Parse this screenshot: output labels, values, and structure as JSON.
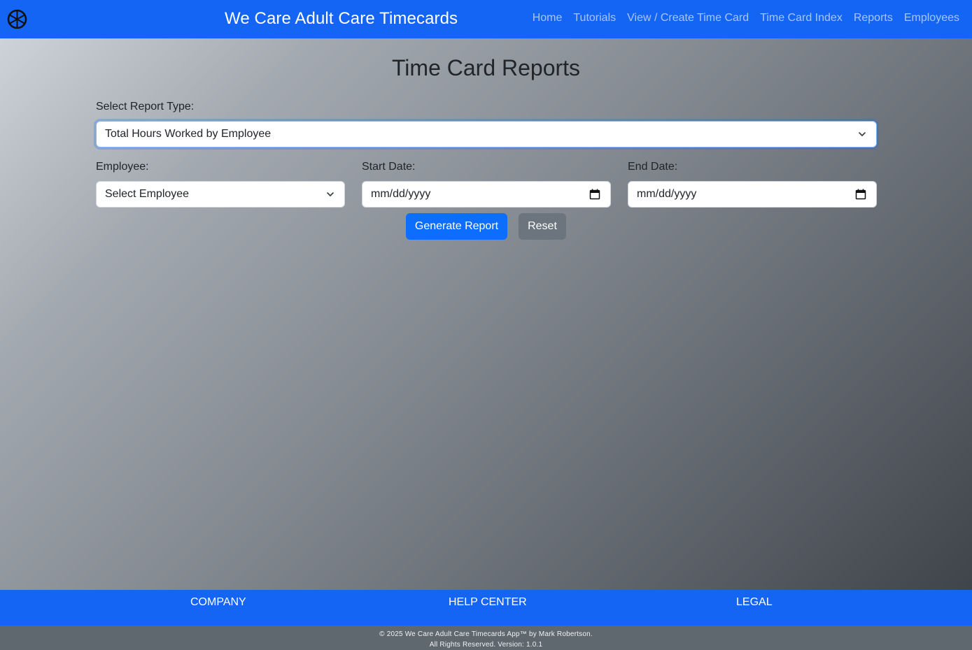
{
  "header": {
    "brand": "We Care Adult Care Timecards",
    "logo_icon": "wheel-icon",
    "nav": [
      "Home",
      "Tutorials",
      "View / Create Time Card",
      "Time Card Index",
      "Reports",
      "Employees"
    ]
  },
  "main": {
    "title": "Time Card Reports",
    "report_type": {
      "label": "Select Report Type:",
      "value": "Total Hours Worked by Employee"
    },
    "employee": {
      "label": "Employee:",
      "value": "Select Employee"
    },
    "start_date": {
      "label": "Start Date:",
      "placeholder": "mm/dd/yyyy"
    },
    "end_date": {
      "label": "End Date:",
      "placeholder": "mm/dd/yyyy"
    },
    "buttons": {
      "generate": "Generate Report",
      "reset": "Reset"
    }
  },
  "footer": {
    "columns": [
      "COMPANY",
      "HELP CENTER",
      "LEGAL"
    ],
    "copyright_line1": "© 2025 We Care Adult Care Timecards App™ by Mark Robertson.",
    "copyright_line2": "All Rights Reserved. Version: 1.0.1"
  },
  "colors": {
    "navbar": "#1565f5",
    "primary_button": "#0d6efd",
    "secondary_button": "#6c757d"
  }
}
